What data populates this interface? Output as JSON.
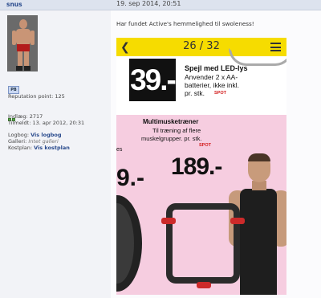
{
  "post": {
    "username": "snus",
    "date": "19. sep 2014, 20:51",
    "message": "Har fundet Active's hemmelighed til swoleness!"
  },
  "profile": {
    "pm_label": "PB",
    "reputation_label": "Reputation point:",
    "reputation_value": "125",
    "posts_label": "Indlæg:",
    "posts_value": "2717",
    "joined_label": "Tilmeldt:",
    "joined_value": "13. apr 2012, 20:31",
    "logbook_label": "Logbog:",
    "logbook_link": "Vis logbog",
    "gallery_label": "Galleri:",
    "gallery_value": "Intet galleri",
    "diet_label": "Kostplan:",
    "diet_link": "Vis kostplan"
  },
  "viewer": {
    "page_counter": "26 / 32",
    "back_icon": "chevron-left-icon",
    "menu_icon": "hamburger-icon",
    "header_color": "#f6dc00"
  },
  "ad": {
    "price_top": "39.-",
    "product_top_title": "Spejl med LED-lys",
    "product_top_line1": "Anvender 2 x AA-",
    "product_top_line2": "batterier, ikke inkl.",
    "product_top_line3": "pr. stk.",
    "spot_label": "SPOT",
    "product_main_title": "Multimusketræner",
    "product_main_line1": "Til træning af flere",
    "product_main_line2": "muskelgrupper. pr. stk.",
    "price_main": "189.-",
    "price_partial": "9.-",
    "partial_text": "es"
  }
}
